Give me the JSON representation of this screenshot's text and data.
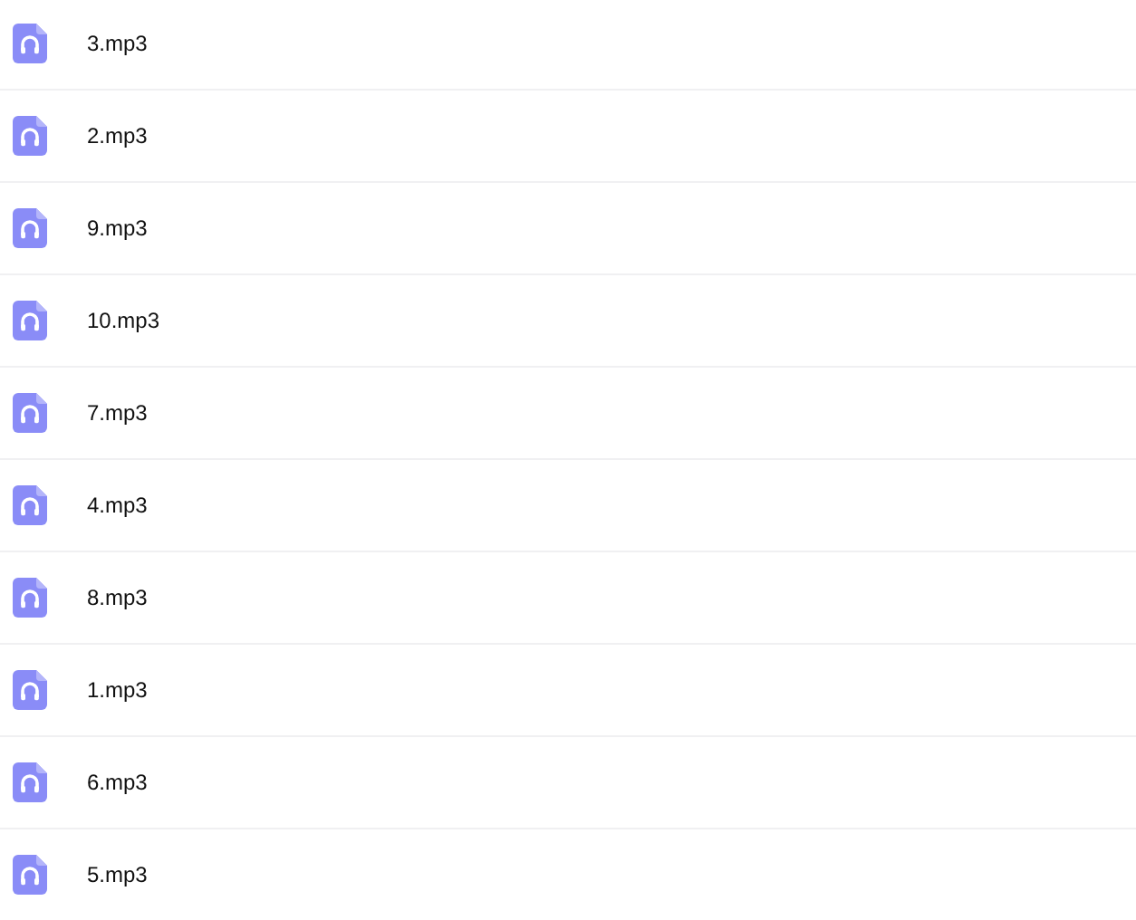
{
  "files": [
    {
      "name": "3.mp3"
    },
    {
      "name": "2.mp3"
    },
    {
      "name": "9.mp3"
    },
    {
      "name": "10.mp3"
    },
    {
      "name": "7.mp3"
    },
    {
      "name": "4.mp3"
    },
    {
      "name": "8.mp3"
    },
    {
      "name": "1.mp3"
    },
    {
      "name": "6.mp3"
    },
    {
      "name": "5.mp3"
    }
  ]
}
